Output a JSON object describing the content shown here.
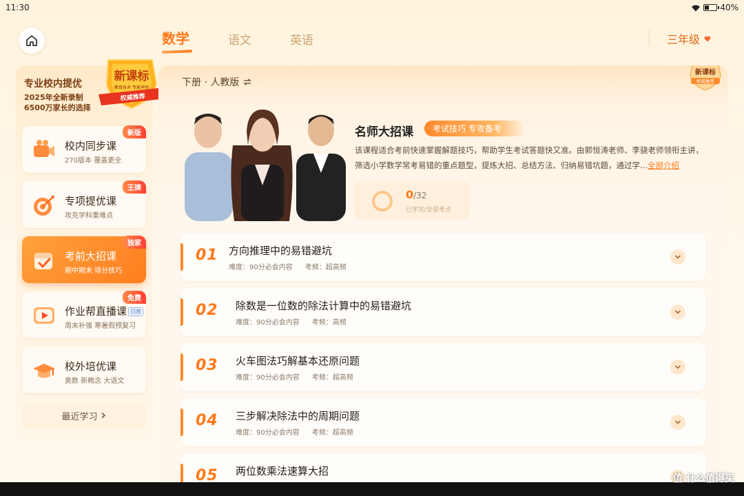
{
  "status_bar": {
    "time": "11:30",
    "battery": "40%",
    "battery_level": 0.4
  },
  "nav": {
    "tabs": [
      {
        "label": "数学",
        "active": true
      },
      {
        "label": "语文",
        "active": false
      },
      {
        "label": "英语",
        "active": false
      }
    ],
    "grade": "三年级"
  },
  "sidebar": {
    "promo": {
      "title": "专业校内提优",
      "line1": "2025年全新录制",
      "line2": "6500万家长的选择",
      "badge_title": "新课标",
      "badge_ribbon": "权威推荐",
      "badge_small": "教育技术 专家声明"
    },
    "items": [
      {
        "title": "校内同步课",
        "subtitle": "270版本 覆盖更全",
        "tag": "新版",
        "icon": "video-camera-icon"
      },
      {
        "title": "专项提优课",
        "subtitle": "攻克学科重难点",
        "tag": "王牌",
        "icon": "target-icon"
      },
      {
        "title": "考前大招课",
        "subtitle": "期中期末 得分技巧",
        "tag": "独家",
        "icon": "calendar-check-icon"
      },
      {
        "title": "作业帮直播课",
        "mini": "回放",
        "subtitle": "周末补强 寒暑假预复习",
        "tag": "免费",
        "icon": "play-icon"
      },
      {
        "title": "校外培优课",
        "subtitle": "奥数 新概念 大语文",
        "tag": "",
        "icon": "graduation-cap-icon"
      }
    ],
    "recent": "最近学习"
  },
  "main": {
    "edition": "下册 · 人教版",
    "corner_badge": {
      "title": "新课标",
      "ribbon": "权威推荐"
    },
    "course": {
      "title": "名师大招课",
      "tag": "考试技巧 专攻备考",
      "description": "该课程适合考前快速掌握解题技巧，帮助学生考试答题快又准。由郭恒涛老师、李骁老师领衔主讲，筛选小学数学常考易错的重点题型，提炼大招、总结方法、归纳易错坑题，通过学...",
      "more": "全部介绍",
      "progress_done": "0",
      "progress_total": "/32",
      "progress_fraction": 0,
      "progress_label": "已学完/全部考点"
    },
    "lessons": [
      {
        "num": "01",
        "title": "方向推理中的易错避坑",
        "difficulty": "难度：90分必会内容",
        "freq": "考频：超高频"
      },
      {
        "num": "02",
        "title": "除数是一位数的除法计算中的易错避坑",
        "difficulty": "难度：90分必会内容",
        "freq": "考频：高频"
      },
      {
        "num": "03",
        "title": "火车图法巧解基本还原问题",
        "difficulty": "难度：90分必会内容",
        "freq": "考频：超高频"
      },
      {
        "num": "04",
        "title": "三步解决除法中的周期问题",
        "difficulty": "难度：90分必会内容",
        "freq": "考频：超高频"
      },
      {
        "num": "05",
        "title": "两位数乘法速算大招",
        "difficulty": "",
        "freq": ""
      }
    ]
  },
  "watermark": "值 什么值得买"
}
